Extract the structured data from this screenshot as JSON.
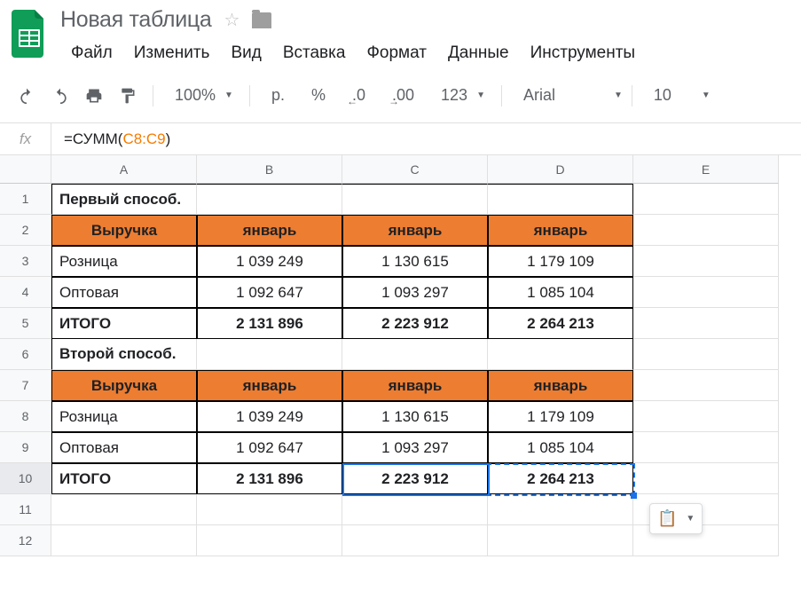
{
  "doc_title": "Новая таблица",
  "menu": [
    "Файл",
    "Изменить",
    "Вид",
    "Вставка",
    "Формат",
    "Данные",
    "Инструменты"
  ],
  "toolbar": {
    "zoom": "100%",
    "currency": "р.",
    "percent": "%",
    "dec_less": ".0",
    "dec_more": ".00",
    "format_123": "123",
    "font": "Arial",
    "font_size": "10"
  },
  "formula": {
    "prefix": "=СУММ",
    "ref": "C8:C9"
  },
  "columns": [
    "A",
    "B",
    "C",
    "D",
    "E"
  ],
  "rows": [
    "1",
    "2",
    "3",
    "4",
    "5",
    "6",
    "7",
    "8",
    "9",
    "10",
    "11",
    "12"
  ],
  "active_row": "10",
  "sheet": {
    "r1": {
      "a": "Первый способ."
    },
    "r2": {
      "a": "Выручка",
      "b": "январь",
      "c": "январь",
      "d": "январь"
    },
    "r3": {
      "a": "Розница",
      "b": "1 039 249",
      "c": "1 130 615",
      "d": "1 179 109"
    },
    "r4": {
      "a": "Оптовая",
      "b": "1 092 647",
      "c": "1 093 297",
      "d": "1 085 104"
    },
    "r5": {
      "a": "ИТОГО",
      "b": "2 131 896",
      "c": "2 223 912",
      "d": "2 264 213"
    },
    "r6": {
      "a": "Второй способ."
    },
    "r7": {
      "a": "Выручка",
      "b": "январь",
      "c": "январь",
      "d": "январь"
    },
    "r8": {
      "a": "Розница",
      "b": "1 039 249",
      "c": "1 130 615",
      "d": "1 179 109"
    },
    "r9": {
      "a": "Оптовая",
      "b": "1 092 647",
      "c": "1 093 297",
      "d": "1 085 104"
    },
    "r10": {
      "a": "ИТОГО",
      "b": "2 131 896",
      "c": "2 223 912",
      "d": "2 264 213"
    }
  }
}
